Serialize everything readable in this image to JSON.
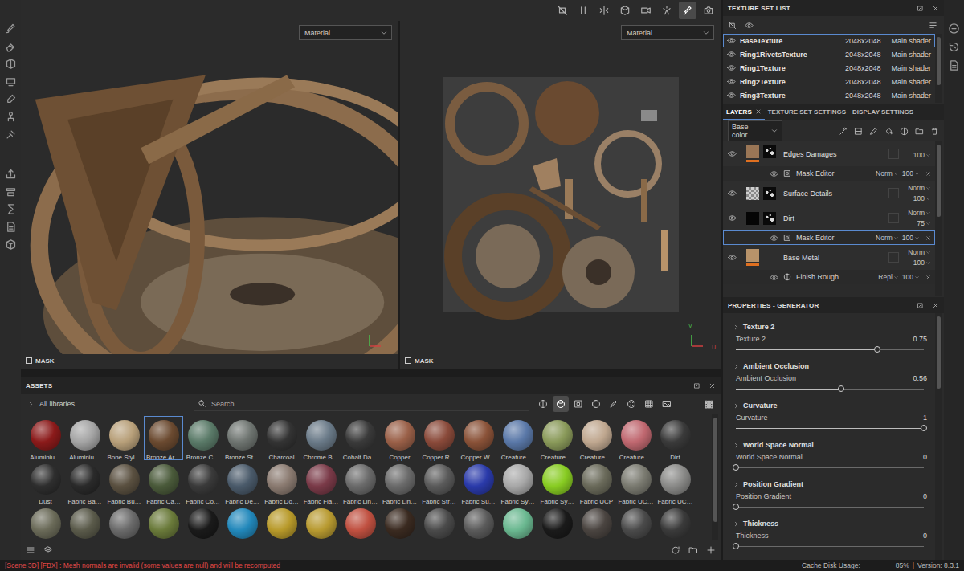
{
  "viewport_toolbar": [
    {
      "kind": "hide",
      "selected": false
    },
    {
      "kind": "pause",
      "selected": false
    },
    {
      "kind": "symmetry",
      "selected": false
    },
    {
      "kind": "display",
      "selected": false
    },
    {
      "kind": "camera",
      "selected": false
    },
    {
      "kind": "bake",
      "selected": false
    },
    {
      "kind": "brush",
      "selected": true
    },
    {
      "kind": "snapshot",
      "selected": false
    }
  ],
  "viewports": [
    {
      "dropdown": "Material",
      "label": "MASK",
      "axis": []
    },
    {
      "dropdown": "Material",
      "label": "MASK",
      "axis": [
        "V",
        "U"
      ]
    }
  ],
  "texture_set_list": {
    "title": "TEXTURE SET LIST",
    "sets": [
      {
        "name": "BaseTexture",
        "resolution": "2048x2048",
        "shader": "Main shader",
        "visible": true,
        "selected": true
      },
      {
        "name": "Ring1RivetsTexture",
        "resolution": "2048x2048",
        "shader": "Main shader",
        "visible": true,
        "selected": false
      },
      {
        "name": "Ring1Texture",
        "resolution": "2048x2048",
        "shader": "Main shader",
        "visible": true,
        "selected": false
      },
      {
        "name": "Ring2Texture",
        "resolution": "2048x2048",
        "shader": "Main shader",
        "visible": true,
        "selected": false
      },
      {
        "name": "Ring3Texture",
        "resolution": "2048x2048",
        "shader": "Main shader",
        "visible": true,
        "selected": false
      }
    ]
  },
  "layers_panel": {
    "tabs": [
      {
        "label": "LAYERS",
        "selected": true,
        "closable": true
      },
      {
        "label": "TEXTURE SET SETTINGS",
        "selected": false,
        "closable": false
      },
      {
        "label": "DISPLAY SETTINGS",
        "selected": false,
        "closable": false
      }
    ],
    "channel": "Base color",
    "layers": [
      {
        "kind": "layer",
        "name": "Edges Damages",
        "blend": "",
        "opacity": "100",
        "color": "#9a7656",
        "checker": false,
        "mask": true,
        "accent": true,
        "visible": true,
        "selected": false
      },
      {
        "kind": "mask",
        "name": "Mask Editor",
        "blend": "Norm",
        "opacity": "100",
        "visible": true,
        "selected": false
      },
      {
        "kind": "layer",
        "name": "Surface Details",
        "blend": "Norm",
        "opacity": "100",
        "color": "#cfcfcf",
        "checker": true,
        "mask": true,
        "accent": false,
        "visible": true,
        "selected": false
      },
      {
        "kind": "layer",
        "name": "Dirt",
        "blend": "Norm",
        "opacity": "75",
        "color": "#050505",
        "checker": false,
        "mask": true,
        "accent": false,
        "visible": true,
        "selected": false
      },
      {
        "kind": "mask",
        "name": "Mask Editor",
        "blend": "Norm",
        "opacity": "100",
        "visible": true,
        "selected": true
      },
      {
        "kind": "layer",
        "name": "Base Metal",
        "blend": "Norm",
        "opacity": "100",
        "color": "#b8936a",
        "checker": false,
        "mask": false,
        "accent": true,
        "visible": true,
        "selected": false
      },
      {
        "kind": "fill",
        "name": "Finish Rough",
        "blend": "Repl",
        "opacity": "100",
        "visible": true,
        "selected": false
      }
    ]
  },
  "properties": {
    "title": "PROPERTIES - GENERATOR",
    "sections": [
      {
        "title": "Texture 2",
        "label": "Texture 2",
        "value": "0.75",
        "level": 0.75
      },
      {
        "title": "Ambient Occlusion",
        "label": "Ambient Occlusion",
        "value": "0.56",
        "level": 0.56
      },
      {
        "title": "Curvature",
        "label": "Curvature",
        "value": "1",
        "level": 1
      },
      {
        "title": "World Space Normal",
        "label": "World Space Normal",
        "value": "0",
        "level": 0
      },
      {
        "title": "Position Gradient",
        "label": "Position Gradient",
        "value": "0",
        "level": 0
      },
      {
        "title": "Thickness",
        "label": "Thickness",
        "value": "0",
        "level": 0
      }
    ]
  },
  "assets": {
    "title": "ASSETS",
    "library": "All libraries",
    "search": {
      "placeholder": "Search"
    },
    "filters": [
      {
        "kind": "all",
        "selected": false
      },
      {
        "kind": "material",
        "selected": true
      },
      {
        "kind": "mask",
        "selected": false
      },
      {
        "kind": "smart",
        "selected": false
      },
      {
        "kind": "brush",
        "selected": false
      },
      {
        "kind": "particle",
        "selected": false
      },
      {
        "kind": "texture",
        "selected": false
      },
      {
        "kind": "environment",
        "selected": false
      }
    ],
    "items": [
      {
        "name": "Aluminiu…",
        "color": "#8b1a1a",
        "selected": false
      },
      {
        "name": "Aluminiu…",
        "color": "#a4a4a4",
        "selected": false
      },
      {
        "name": "Bone Styl…",
        "color": "#b8a07a",
        "selected": false
      },
      {
        "name": "Bronze Ar…",
        "color": "#6b4a30",
        "selected": true
      },
      {
        "name": "Bronze C…",
        "color": "#5a7a68",
        "selected": false
      },
      {
        "name": "Bronze St…",
        "color": "#6e7470",
        "selected": false
      },
      {
        "name": "Charcoal",
        "color": "#333333",
        "selected": false
      },
      {
        "name": "Chrome B…",
        "color": "#6a7a88",
        "selected": false
      },
      {
        "name": "Cobalt Da…",
        "color": "#3a3a3a",
        "selected": false
      },
      {
        "name": "Copper",
        "color": "#9a6048",
        "selected": false
      },
      {
        "name": "Copper R…",
        "color": "#8a4a3a",
        "selected": false
      },
      {
        "name": "Copper W…",
        "color": "#8a5238",
        "selected": false
      },
      {
        "name": "Creature …",
        "color": "#5a78a8",
        "selected": false
      },
      {
        "name": "Creature …",
        "color": "#8a9a5a",
        "selected": false
      },
      {
        "name": "Creature …",
        "color": "#c0a890",
        "selected": false
      },
      {
        "name": "Creature …",
        "color": "#c06870",
        "selected": false
      },
      {
        "name": "Dirt",
        "color": "#3a3a3a",
        "selected": false
      },
      {
        "name": "Dust",
        "color": "#2e2e2e",
        "selected": false
      },
      {
        "name": "Fabric Ba…",
        "color": "#2a2a2a",
        "selected": false
      },
      {
        "name": "Fabric Bu…",
        "color": "#5a5040",
        "selected": false
      },
      {
        "name": "Fabric Ca…",
        "color": "#4a5a3a",
        "selected": false
      },
      {
        "name": "Fabric Co…",
        "color": "#3a3a3a",
        "selected": false
      },
      {
        "name": "Fabric De…",
        "color": "#4a5a6a",
        "selected": false
      },
      {
        "name": "Fabric Do…",
        "color": "#8a7a70",
        "selected": false
      },
      {
        "name": "Fabric Fla…",
        "color": "#7a3a48",
        "selected": false
      },
      {
        "name": "Fabric Lin…",
        "color": "#6a6a6a",
        "selected": false
      },
      {
        "name": "Fabric Lin…",
        "color": "#6a6a6a",
        "selected": false
      },
      {
        "name": "Fabric Str…",
        "color": "#5a5a5a",
        "selected": false
      },
      {
        "name": "Fabric Su…",
        "color": "#2a3aaa",
        "selected": false
      },
      {
        "name": "Fabric Sy…",
        "color": "#a8a8a8",
        "selected": false
      },
      {
        "name": "Fabric Sy…",
        "color": "#88cc22",
        "selected": false
      },
      {
        "name": "Fabric UCP",
        "color": "#6a6a5a",
        "selected": false
      },
      {
        "name": "Fabric UC…",
        "color": "#7a7a70",
        "selected": false
      },
      {
        "name": "Fabric UC…",
        "color": "#8a8a88",
        "selected": false
      }
    ],
    "partial_row": [
      {
        "color": "#6a6a58"
      },
      {
        "color": "#5a5a4a"
      },
      {
        "color": "#6a6a6a"
      },
      {
        "color": "#6a7a3a"
      },
      {
        "color": "#1a1a1a"
      },
      {
        "color": "#2288bb"
      },
      {
        "color": "#b89a2a"
      },
      {
        "color": "#b89a30"
      },
      {
        "color": "#c05040"
      },
      {
        "color": "#3a2a20"
      },
      {
        "color": "#4a4a4a"
      },
      {
        "color": "#5a5a5a"
      },
      {
        "color": "#6ab890"
      },
      {
        "color": "#1a1a1a"
      },
      {
        "color": "#4a4440"
      },
      {
        "color": "#4a4a4a"
      },
      {
        "color": "#3a3a3a"
      }
    ]
  },
  "status_bar": {
    "message": "[Scene 3D] [FBX] : Mesh normals are invalid (some values are null) and will be recomputed",
    "cache_label": "Cache Disk Usage:",
    "cache_value": "85%",
    "separator": "|",
    "version": "Version: 8.3.1"
  }
}
